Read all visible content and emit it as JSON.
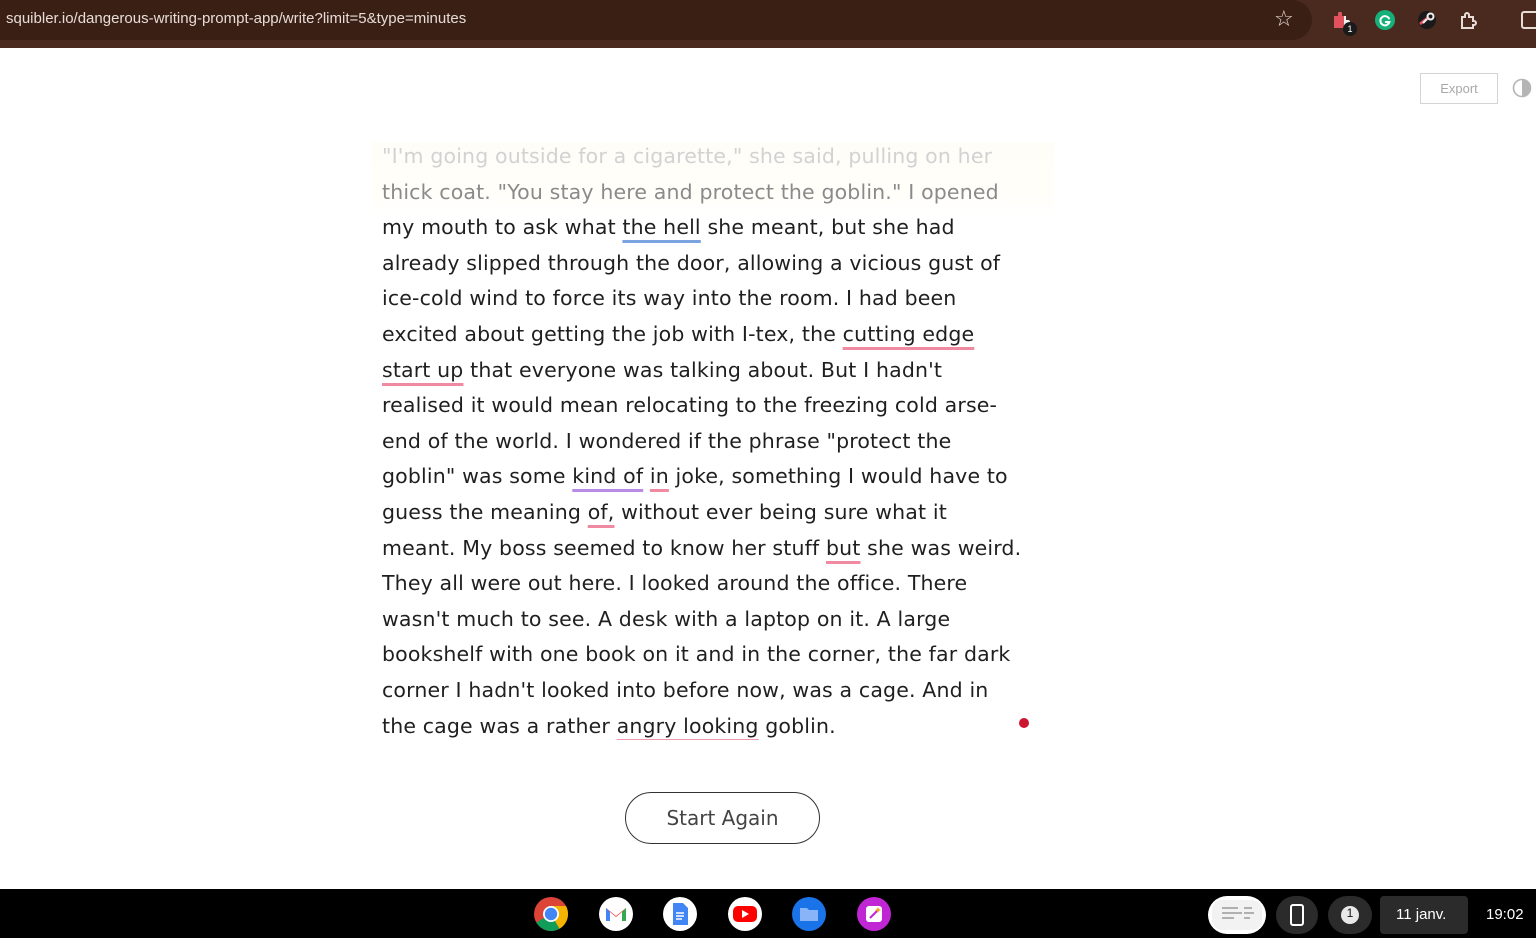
{
  "browser": {
    "url": "squibler.io/dangerous-writing-prompt-app/write?limit=5&type=minutes",
    "star_glyph": "☆",
    "ext_badge_count": "1",
    "icons": [
      "bookmark-star-icon",
      "extension-puzzle-icon",
      "grammarly-icon",
      "extension-key-icon",
      "extensions-icon",
      "side-panel-icon"
    ]
  },
  "toolbar": {
    "export_label": "Export",
    "contrast_icon": "contrast-toggle-icon"
  },
  "editor": {
    "lines": [
      {
        "parts": [
          {
            "t": "\"I'm going outside for a cigarette,\" she said, pulling on her"
          }
        ]
      },
      {
        "parts": [
          {
            "t": "thick coat. \"You stay here and protect the goblin.\" I opened"
          }
        ]
      },
      {
        "parts": [
          {
            "t": "my mouth to ask what "
          },
          {
            "t": "the hell"
          },
          {
            "t": " she meant, but she had"
          }
        ]
      },
      {
        "parts": [
          {
            "t": "already slipped through the door, allowing a vicious gust of"
          }
        ]
      },
      {
        "parts": [
          {
            "t": "ice-cold wind to force its way into the room. I had been"
          }
        ]
      },
      {
        "parts": [
          {
            "t": "excited about getting the job with I-tex, the "
          },
          {
            "t": "cutting edge"
          }
        ]
      },
      {
        "parts": [
          {
            "t": "start up"
          },
          {
            "t": " that everyone was talking about. But I hadn't"
          }
        ]
      },
      {
        "parts": [
          {
            "t": "realised it would mean relocating to the freezing cold arse-"
          }
        ]
      },
      {
        "parts": [
          {
            "t": "end of the world. I wondered if the phrase \"protect the"
          }
        ]
      },
      {
        "parts": [
          {
            "t": "goblin\" was some "
          },
          {
            "t": "kind of"
          },
          {
            "t": " "
          },
          {
            "t": "in"
          },
          {
            "t": " joke, something I would have to"
          }
        ]
      },
      {
        "parts": [
          {
            "t": "guess the meaning "
          },
          {
            "t": "of,"
          },
          {
            "t": " without ever being sure what it"
          }
        ]
      },
      {
        "parts": [
          {
            "t": "meant. My boss seemed to know her stuff "
          },
          {
            "t": "but"
          },
          {
            "t": " she was weird."
          }
        ]
      },
      {
        "parts": [
          {
            "t": "They all were out here. I looked around the office. There"
          }
        ]
      },
      {
        "parts": [
          {
            "t": "wasn't much to see. A desk with a laptop on it. A large"
          }
        ]
      },
      {
        "parts": [
          {
            "t": "bookshelf with one book on it and in the corner, the far dark"
          }
        ]
      },
      {
        "parts": [
          {
            "t": "corner I hadn't looked into before now, was a cage. And in"
          }
        ]
      },
      {
        "parts": [
          {
            "t": "the cage was a rather "
          },
          {
            "t": "angry looking"
          },
          {
            "t": " goblin."
          }
        ]
      }
    ],
    "start_again_label": "Start Again"
  },
  "shelf": {
    "apps": [
      "chrome-icon",
      "gmail-icon",
      "docs-icon",
      "youtube-icon",
      "files-icon",
      "creative-app-icon"
    ],
    "notification_count": "1",
    "date": "11 janv.",
    "time": "19:02",
    "colors": {
      "background": "#000000",
      "pill": "#2b2b2b"
    }
  }
}
